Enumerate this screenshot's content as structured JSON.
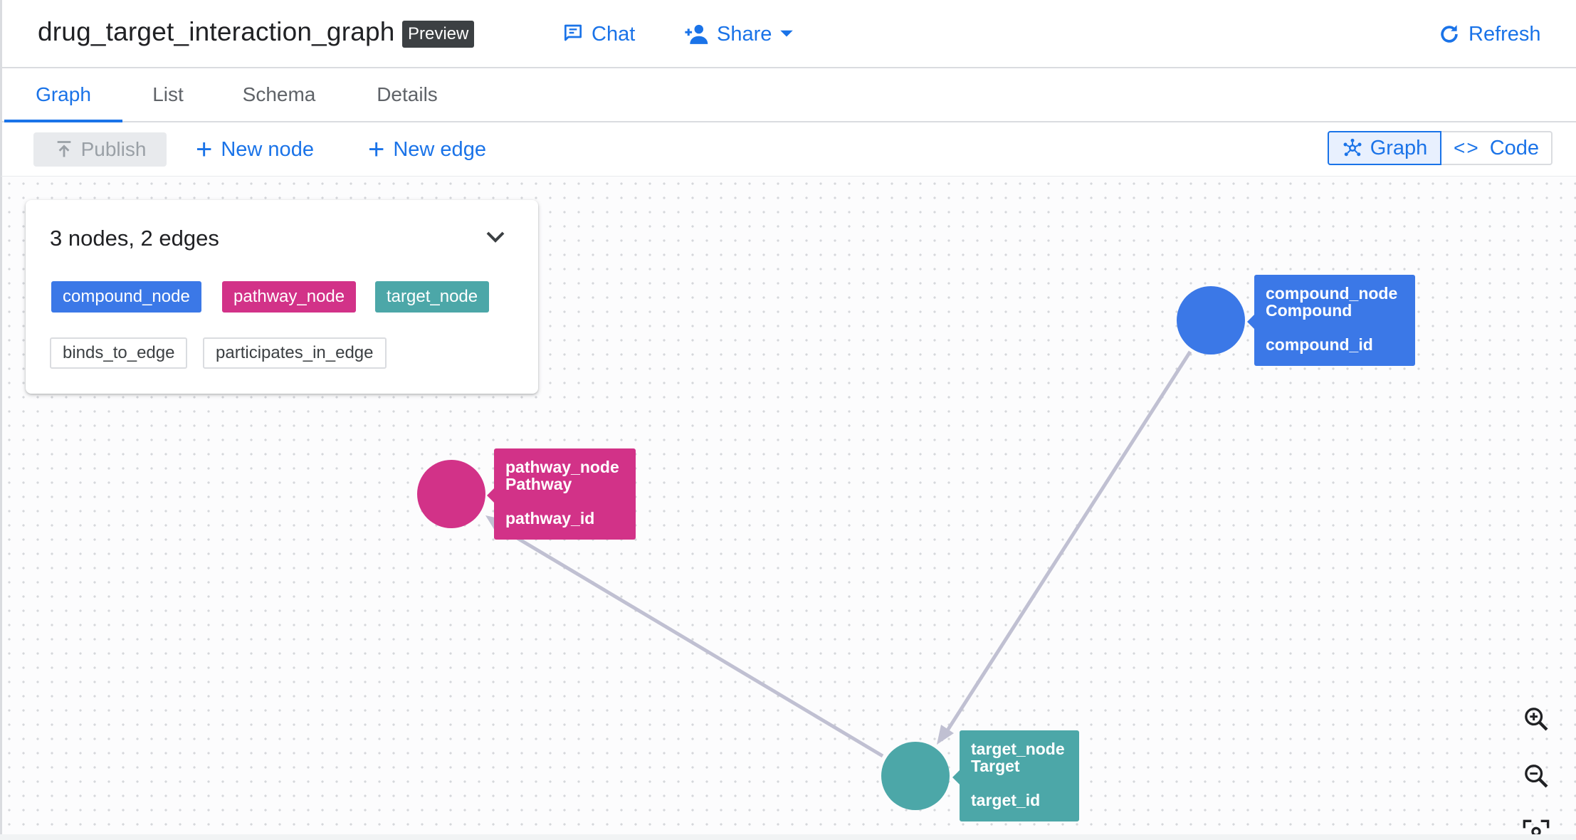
{
  "header": {
    "title": "drug_target_interaction_graph",
    "badge": "Preview",
    "chat_label": "Chat",
    "share_label": "Share",
    "refresh_label": "Refresh"
  },
  "tabs": [
    {
      "label": "Graph",
      "active": true
    },
    {
      "label": "List",
      "active": false
    },
    {
      "label": "Schema",
      "active": false
    },
    {
      "label": "Details",
      "active": false
    }
  ],
  "toolbar": {
    "publish_label": "Publish",
    "new_node_label": "New node",
    "new_edge_label": "New edge",
    "view_toggle": {
      "graph_label": "Graph",
      "code_label": "Code",
      "selected": "Graph"
    }
  },
  "summary": {
    "title": "3 nodes, 2 edges",
    "node_types": [
      "compound_node",
      "pathway_node",
      "target_node"
    ],
    "edge_types": [
      "binds_to_edge",
      "participates_in_edge"
    ]
  },
  "graph": {
    "nodes": [
      {
        "type": "compound_node",
        "label": "Compound",
        "key": "compound_id",
        "color": "#3b78e7"
      },
      {
        "type": "pathway_node",
        "label": "Pathway",
        "key": "pathway_id",
        "color": "#d23288"
      },
      {
        "type": "target_node",
        "label": "Target",
        "key": "target_id",
        "color": "#4ca7a8"
      }
    ],
    "edges": [
      {
        "from": "compound_node",
        "to": "target_node"
      },
      {
        "from": "target_node",
        "to": "pathway_node"
      }
    ]
  },
  "colors": {
    "accent": "#1a73e8",
    "compound": "#3b78e7",
    "pathway": "#d23288",
    "target": "#4ca7a8",
    "edge": "#c0c0d2"
  },
  "icons": {
    "chat": "chat-add-icon",
    "share": "person-add-icon",
    "refresh": "refresh-icon",
    "publish": "publish-icon",
    "graph_view": "graph-network-icon",
    "code_view": "code-brackets-icon",
    "zoom_in": "zoom-in-icon",
    "zoom_out": "zoom-out-icon",
    "fit": "fit-screen-icon"
  }
}
